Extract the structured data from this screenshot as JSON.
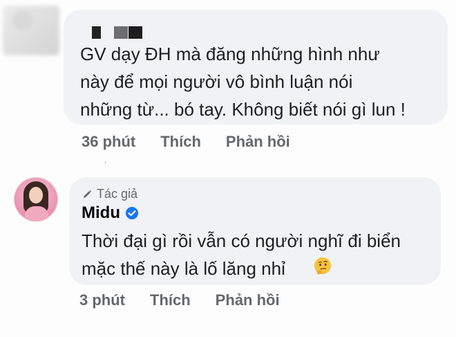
{
  "comments": [
    {
      "text": "GV dạy ĐH mà đăng những hình như\nnày để mọi người vô bình luận nói\nnhững từ... bó tay. Không biết nói gì lun !",
      "time": "36 phút",
      "like_label": "Thích",
      "reply_label": "Phản hồi"
    },
    {
      "author_badge": "Tác giả",
      "author_name": "Midu",
      "text": "Thời đại gì rồi vẫn có người nghĩ đi biển\nmặc thế này là lố lăng nhỉ",
      "emoji": "thinking-face-icon",
      "time": "3 phút",
      "like_label": "Thích",
      "reply_label": "Phản hồi"
    }
  ],
  "colors": {
    "bubble_bg": "#f0f2f5",
    "secondary_text": "#65676b",
    "verified_blue": "#1877f2"
  }
}
